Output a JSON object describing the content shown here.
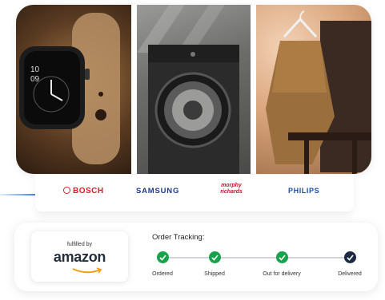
{
  "hero": {
    "panels": [
      {
        "name": "smartwatch"
      },
      {
        "name": "washing-machine"
      },
      {
        "name": "apparel-on-chair"
      }
    ]
  },
  "brands": [
    "BOSCH",
    "SAMSUNG",
    "morphy richards",
    "PHILIPS"
  ],
  "fulfillment": {
    "label": "fulfilled by",
    "brand": "amazon"
  },
  "tracking": {
    "title": "Order Tracking:",
    "steps": [
      {
        "label": "Ordered",
        "status": "done"
      },
      {
        "label": "Shipped",
        "status": "done"
      },
      {
        "label": "Out for delivery",
        "status": "done"
      },
      {
        "label": "Delivered",
        "status": "current"
      }
    ],
    "colors": {
      "done": "#16a34a",
      "current": "#1e2a44",
      "line": "#d0d4da"
    }
  }
}
